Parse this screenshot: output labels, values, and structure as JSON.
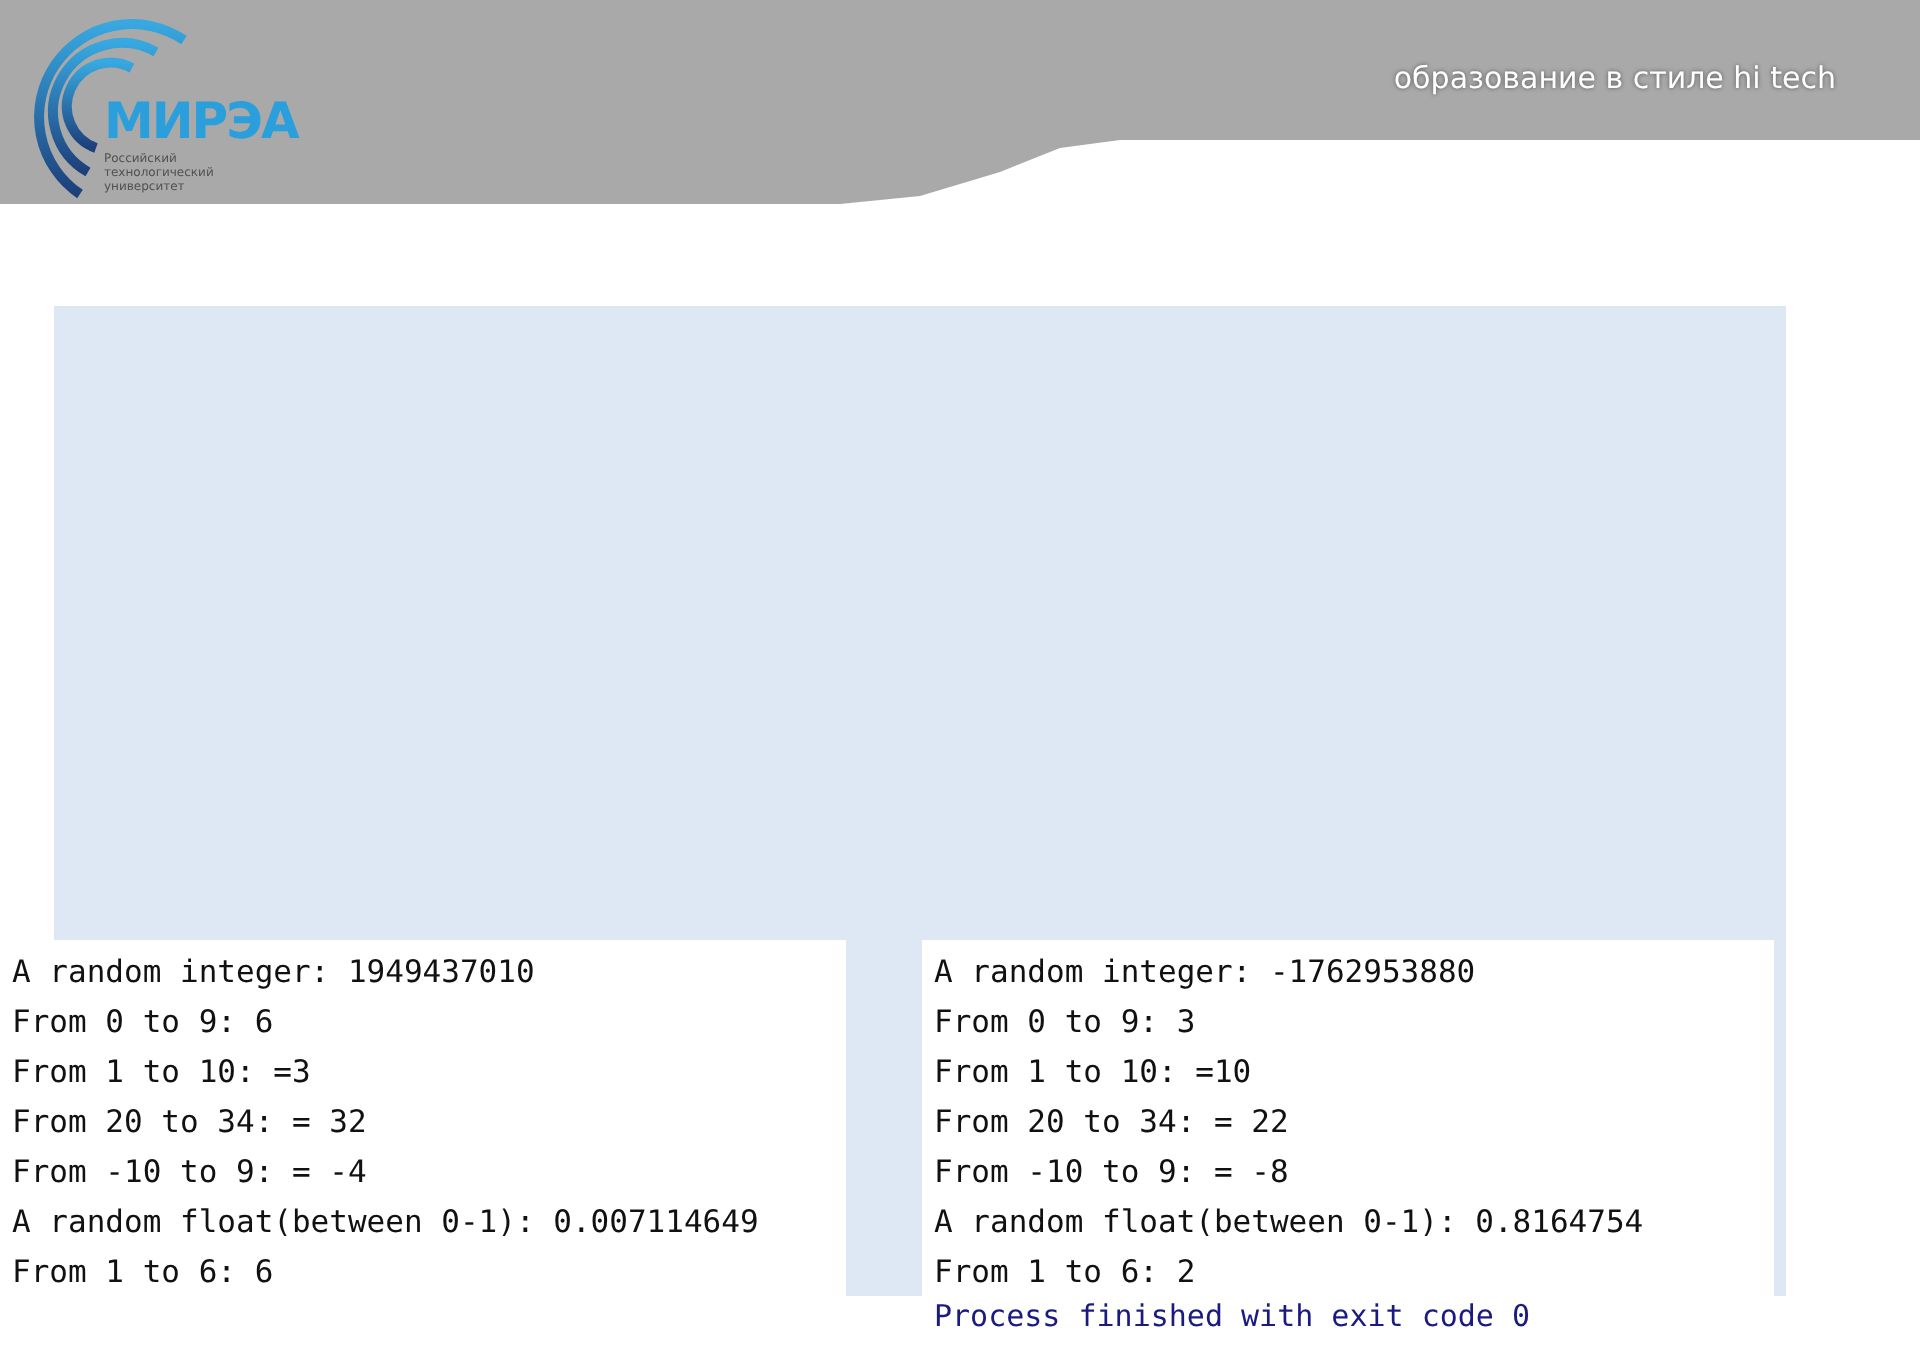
{
  "header": {
    "logo": {
      "wordmark": "МИРЭА",
      "subtitle_lines": [
        "Российский",
        "технологический",
        "университет"
      ]
    },
    "slogan": "образование в стиле hi tech"
  },
  "consoles": [
    {
      "lines": [
        "A random integer: 1949437010",
        "From 0 to 9: 6",
        "From 1 to 10: =3",
        "From 20 to 34: = 32",
        "From -10 to 9: = -4",
        "A random float(between 0-1): 0.007114649",
        "From 1 to 6: 6"
      ]
    },
    {
      "lines": [
        "A random integer: -1762953880",
        "From 0 to 9: 3",
        "From 1 to 10: =10",
        "From 20 to 34: = 22",
        "From -10 to 9: = -8",
        "A random float(between 0-1): 0.8164754",
        "From 1 to 6: 2"
      ],
      "footer": "Process finished with exit code 0"
    }
  ]
}
